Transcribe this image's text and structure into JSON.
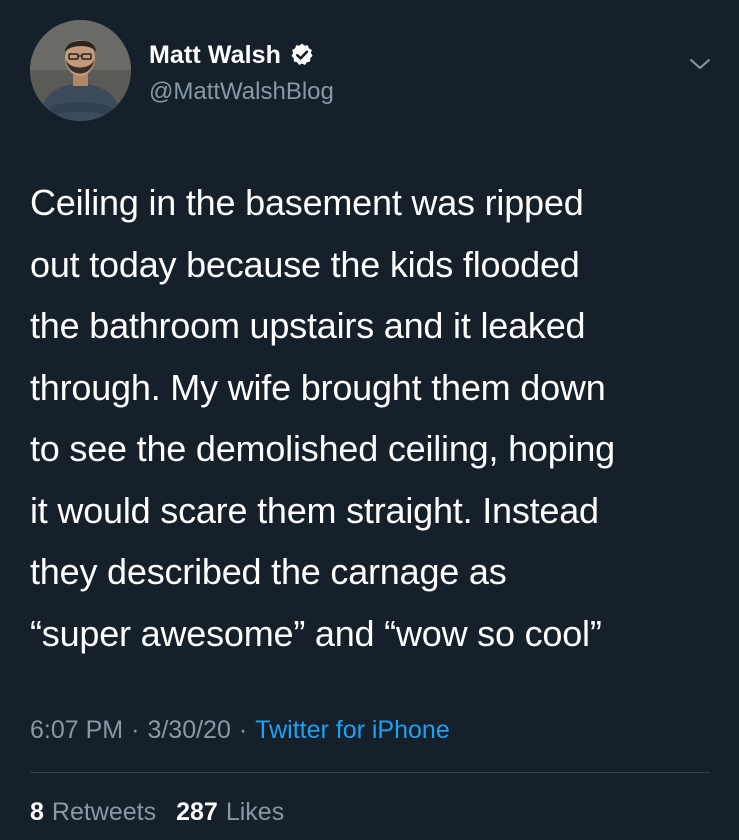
{
  "colors": {
    "background": "#15202b",
    "text_primary": "#ffffff",
    "text_secondary": "#8899a6",
    "link": "#1da1f2",
    "divider": "#38444d"
  },
  "header": {
    "display_name": "Matt Walsh",
    "handle": "@MattWalshBlog",
    "verified_icon": "verified-badge-icon",
    "menu_icon": "chevron-down-icon"
  },
  "tweet": {
    "text": "Ceiling in the basement was ripped\nout today because the kids flooded\nthe bathroom upstairs and it leaked\nthrough. My wife brought them down\nto see the demolished ceiling, hoping\nit would scare them straight. Instead\nthey described the carnage as\n“super awesome” and “wow so cool”"
  },
  "meta": {
    "time": "6:07 PM",
    "separator": "·",
    "date": "3/30/20",
    "source": "Twitter for iPhone"
  },
  "stats": {
    "retweets_count": "8",
    "retweets_label": "Retweets",
    "likes_count": "287",
    "likes_label": "Likes"
  }
}
